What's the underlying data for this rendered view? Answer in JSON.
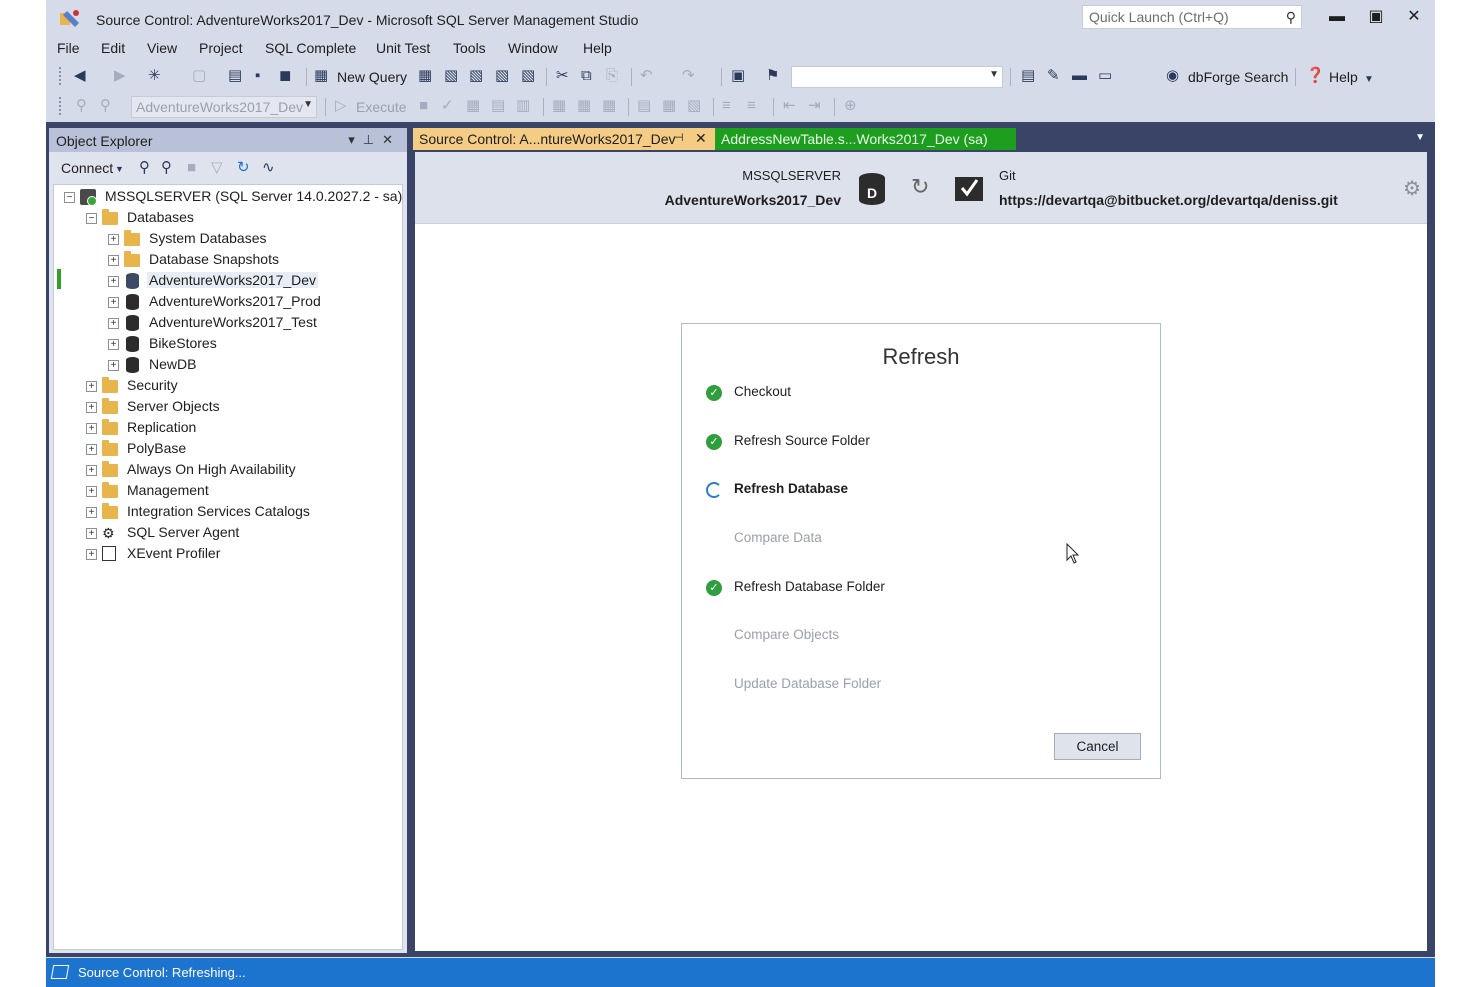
{
  "window": {
    "title": "Source Control: AdventureWorks2017_Dev - Microsoft SQL Server Management Studio",
    "quick_launch_placeholder": "Quick Launch (Ctrl+Q)",
    "minimize_icon": "minimize-icon",
    "maximize_icon": "maximize-icon",
    "close_icon": "close-icon"
  },
  "menu": [
    "File",
    "Edit",
    "View",
    "Project",
    "SQL Complete",
    "Unit Test",
    "Tools",
    "Window",
    "Help"
  ],
  "toolbar": {
    "new_query": "New Query",
    "dbforge_search": "dbForge Search",
    "help": "Help",
    "database_combo": "AdventureWorks2017_Dev",
    "execute": "Execute"
  },
  "object_explorer": {
    "title": "Object Explorer",
    "connect": "Connect",
    "tree": {
      "server": "MSSQLSERVER (SQL Server 14.0.2027.2 - sa)",
      "databases_folder": "Databases",
      "databases": [
        "System Databases",
        "Database Snapshots",
        "AdventureWorks2017_Dev",
        "AdventureWorks2017_Prod",
        "AdventureWorks2017_Test",
        "BikeStores",
        "NewDB"
      ],
      "server_nodes": [
        "Security",
        "Server Objects",
        "Replication",
        "PolyBase",
        "Always On High Availability",
        "Management",
        "Integration Services Catalogs",
        "SQL Server Agent",
        "XEvent Profiler"
      ]
    }
  },
  "tabs": {
    "active": "Source Control: A...ntureWorks2017_Dev",
    "second": "AddressNewTable.s...Works2017_Dev (sa)"
  },
  "source_control": {
    "server": "MSSQLSERVER",
    "database": "AdventureWorks2017_Dev",
    "repo_type": "Git",
    "repo_url": "https://devartqa@bitbucket.org/devartqa/deniss.git"
  },
  "refresh_dialog": {
    "title": "Refresh",
    "steps": [
      {
        "label": "Checkout",
        "status": "done"
      },
      {
        "label": "Refresh Source Folder",
        "status": "done"
      },
      {
        "label": "Refresh Database",
        "status": "running"
      },
      {
        "label": "Compare Data",
        "status": "pending"
      },
      {
        "label": "Refresh Database Folder",
        "status": "done"
      },
      {
        "label": "Compare Objects",
        "status": "pending"
      },
      {
        "label": "Update Database Folder",
        "status": "pending"
      }
    ],
    "cancel": "Cancel"
  },
  "status_bar": {
    "text": "Source Control: Refreshing..."
  },
  "colors": {
    "accent_tab": "#f5cc84",
    "green_tab": "#1e9e1e",
    "status_bar": "#1c74cf",
    "success": "#2e9e3e",
    "progress": "#2d7bd6"
  }
}
